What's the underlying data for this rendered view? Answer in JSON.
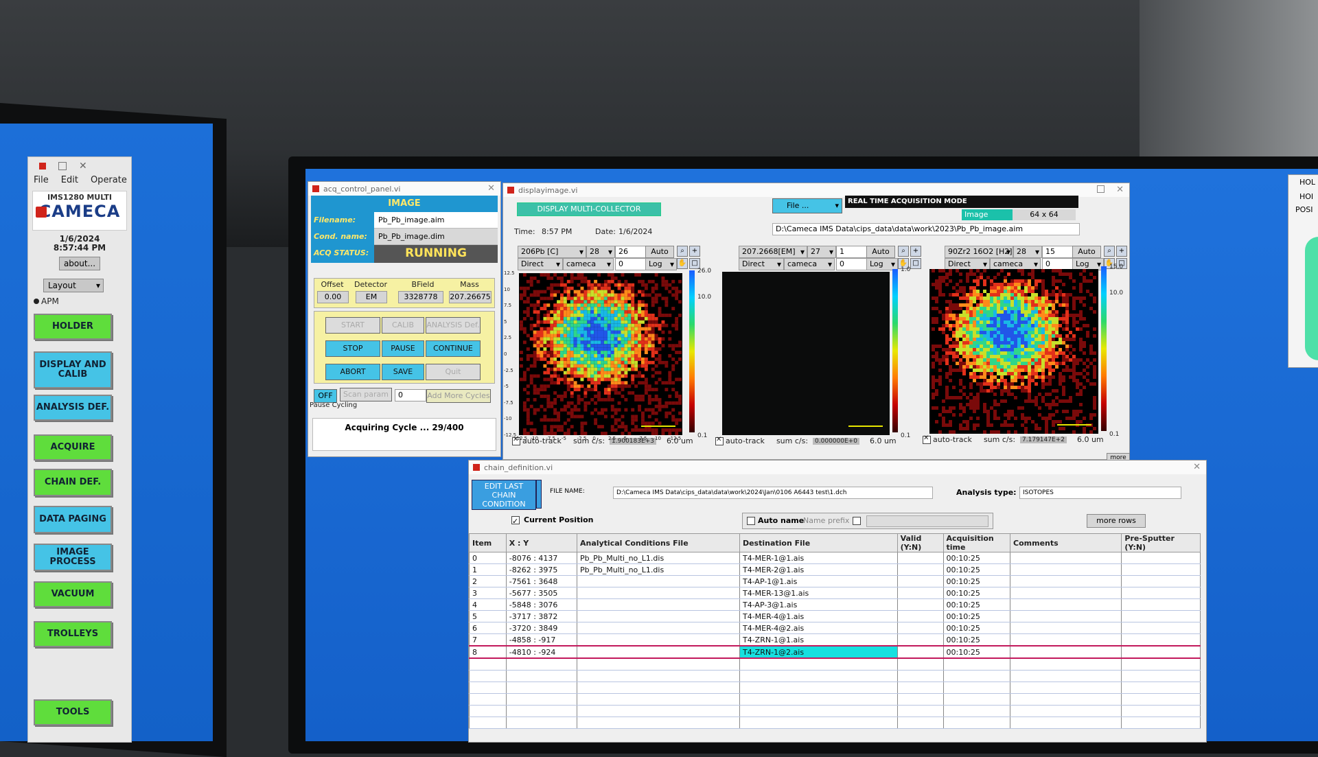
{
  "toolbar_window": {
    "menu": [
      "File",
      "Edit",
      "Operate"
    ],
    "logo_top": "IMS1280 MULTI",
    "logo_name": "CAMECA",
    "date": "1/6/2024",
    "time": "8:57:44 PM",
    "about": "about...",
    "layout": "Layout",
    "apm": "APM",
    "buttons": [
      "HOLDER",
      "DISPLAY AND CALIB",
      "ANALYSIS DEF.",
      "ACQUIRE",
      "CHAIN DEF.",
      "DATA PAGING",
      "IMAGE PROCESS",
      "VACUUM",
      "TROLLEYS",
      "TOOLS"
    ]
  },
  "acq": {
    "title": "acq_control_panel.vi",
    "mode": "IMAGE",
    "filename_label": "Filename:",
    "filename": "Pb_Pb_image.aim",
    "cond_label": "Cond. name:",
    "cond": "Pb_Pb_image.dim",
    "status_label": "ACQ STATUS:",
    "status": "RUNNING",
    "offset_h": "Offset",
    "detector_h": "Detector",
    "bfield_h": "BField",
    "mass_h": "Mass",
    "offset": "0.00",
    "detector": "EM",
    "bfield": "3328778",
    "mass": "207.26675",
    "start": "START",
    "calib": "CALIB",
    "analysis": "ANALYSIS Def.",
    "stop": "STOP",
    "pause": "PAUSE",
    "continue": "CONTINUE",
    "abort": "ABORT",
    "save": "SAVE",
    "quit": "Quit",
    "off": "OFF",
    "scan": "Scan param",
    "cycles": "0",
    "add_cycles": "Add More Cycles",
    "pause_cycling": "Pause Cycling",
    "cycle_text": "Acquiring  Cycle ... 29/400"
  },
  "display": {
    "title": "displayimage.vi",
    "mode_btn": "DISPLAY MULTI-COLLECTOR",
    "time_label": "Time:",
    "time": "8:57 PM",
    "date_label": "Date:",
    "date": "1/6/2024",
    "file_btn": "File ...",
    "rt_mode": "REAL TIME ACQUISITION MODE",
    "rt_image": "Image",
    "rt_size": "64 x 64",
    "path": "D:\\Cameca IMS Data\\cips_data\\data\\work\\2023\\Pb_Pb_image.aim",
    "panels": [
      {
        "species": "206Pb [C]",
        "v1": "28",
        "v2": "26",
        "auto": "Auto",
        "mode": "Direct",
        "cal": "cameca",
        "v3": "0",
        "scale": "Log",
        "cb_top": "26.0",
        "cb_mid": "10.0",
        "cb_bot": "0.1",
        "sum": "1.900183E+3",
        "scalebar": "6.0 um",
        "autotrack": "auto-track",
        "sum_label": "sum c/s:"
      },
      {
        "species": "207.2668[EM]",
        "v1": "27",
        "v2": "1",
        "auto": "Auto",
        "mode": "Direct",
        "cal": "cameca",
        "v3": "0",
        "scale": "Log",
        "cb_top": "1.0",
        "cb_mid": "",
        "cb_bot": "0.1",
        "sum": "0.000000E+0",
        "scalebar": "6.0 um",
        "autotrack": "auto-track",
        "sum_label": "sum c/s:"
      },
      {
        "species": "90Zr2 16O2 [H2]",
        "v1": "28",
        "v2": "15",
        "auto": "Auto",
        "mode": "Direct",
        "cal": "cameca",
        "v3": "0",
        "scale": "Log",
        "cb_top": "15.0",
        "cb_mid": "10.0",
        "cb_bot": "0.1",
        "sum": "7.179147E+2",
        "scalebar": "6.0 um",
        "autotrack": "auto-track",
        "sum_label": "sum c/s:"
      }
    ],
    "y_ticks": [
      "12.5",
      "10",
      "7.5",
      "5",
      "2.5",
      "0",
      "-2.5",
      "-5",
      "-7.5",
      "-10",
      "-12.5"
    ],
    "x_ticks": [
      "-12.5",
      "-10",
      "-7.5",
      "-5",
      "-2.5",
      "0",
      "2.5",
      "5",
      "7.5",
      "10",
      "12.5"
    ],
    "more": "more"
  },
  "chain": {
    "title": "chain_definition.vi",
    "edit_btn": "EDIT LAST CHAIN CONDITION",
    "file_label": "FILE NAME:",
    "file": "D:\\Cameca IMS Data\\cips_data\\data\\work\\2024\\Jan\\0106 A6443 test\\1.dch",
    "analysis_label": "Analysis type:",
    "analysis": "ISOTOPES",
    "current_position": "Current Position",
    "auto_name": "Auto name",
    "name_prefix": "Name prefix",
    "more_rows": "more rows",
    "headers": [
      "Item",
      "X  :  Y",
      "Analytical Conditions File",
      "Destination File",
      "Valid (Y:N)",
      "Acquisition time",
      "Comments",
      "Pre-Sputter (Y:N)"
    ],
    "rows": [
      [
        "0",
        "-8076 : 4137",
        "Pb_Pb_Multi_no_L1.dis",
        "T4-MER-1@1.ais",
        "",
        "00:10:25",
        "",
        ""
      ],
      [
        "1",
        "-8262 : 3975",
        "Pb_Pb_Multi_no_L1.dis",
        "T4-MER-2@1.ais",
        "",
        "00:10:25",
        "",
        ""
      ],
      [
        "2",
        "-7561 : 3648",
        "",
        "T4-AP-1@1.ais",
        "",
        "00:10:25",
        "",
        ""
      ],
      [
        "3",
        "-5677 : 3505",
        "",
        "T4-MER-13@1.ais",
        "",
        "00:10:25",
        "",
        ""
      ],
      [
        "4",
        "-5848 : 3076",
        "",
        "T4-AP-3@1.ais",
        "",
        "00:10:25",
        "",
        ""
      ],
      [
        "5",
        "-3717 : 3872",
        "",
        "T4-MER-4@1.ais",
        "",
        "00:10:25",
        "",
        ""
      ],
      [
        "6",
        "-3720 : 3849",
        "",
        "T4-MER-4@2.ais",
        "",
        "00:10:25",
        "",
        ""
      ],
      [
        "7",
        "-4858 : -917",
        "",
        "T4-ZRN-1@1.ais",
        "",
        "00:10:25",
        "",
        ""
      ],
      [
        "8",
        "-4810 : -924",
        "",
        "T4-ZRN-1@2.ais",
        "",
        "00:10:25",
        "",
        ""
      ]
    ]
  },
  "right_window": {
    "t1": "HOL",
    "t2": "HOI",
    "t3": "POSI"
  }
}
